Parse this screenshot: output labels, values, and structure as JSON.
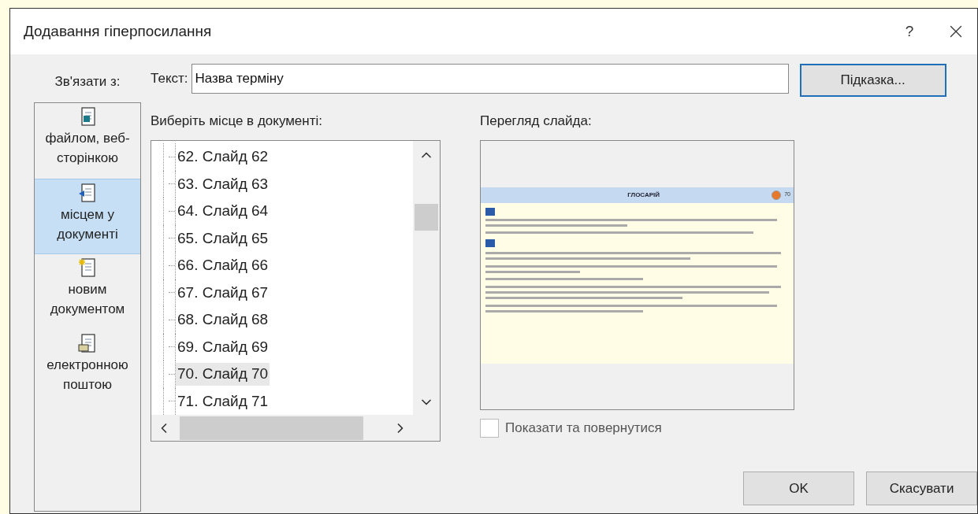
{
  "window": {
    "title": "Додавання гіперпосилання",
    "help": "?"
  },
  "link_to": {
    "label": "Зв'язати з:",
    "items": [
      {
        "label": "файлом, веб-сторінкою",
        "kind": "file",
        "selected": false
      },
      {
        "label": "місцем у документі",
        "kind": "place",
        "selected": true
      },
      {
        "label": "новим документом",
        "kind": "new",
        "selected": false
      },
      {
        "label": "електронною поштою",
        "kind": "mail",
        "selected": false
      }
    ]
  },
  "text_field": {
    "label": "Текст:",
    "value": "Назва терміну"
  },
  "hint_button": "Підказка...",
  "place_list": {
    "label": "Виберіть місце в документі:",
    "items": [
      {
        "label": "62. Слайд 62",
        "selected": false
      },
      {
        "label": "63. Слайд 63",
        "selected": false
      },
      {
        "label": "64. Слайд 64",
        "selected": false
      },
      {
        "label": "65. Слайд 65",
        "selected": false
      },
      {
        "label": "66. Слайд 66",
        "selected": false
      },
      {
        "label": "67. Слайд 67",
        "selected": false
      },
      {
        "label": "68. Слайд 68",
        "selected": false
      },
      {
        "label": "69. Слайд 69",
        "selected": false
      },
      {
        "label": "70. Слайд 70",
        "selected": true
      },
      {
        "label": "71. Слайд 71",
        "selected": false
      }
    ]
  },
  "preview": {
    "label": "Перегляд слайда:",
    "slide_title": "ГЛОСАРІЙ",
    "slide_number": "70"
  },
  "show_and_return": {
    "label": "Показати та повернутися",
    "checked": false
  },
  "buttons": [
    "OK",
    "Скасувати"
  ]
}
